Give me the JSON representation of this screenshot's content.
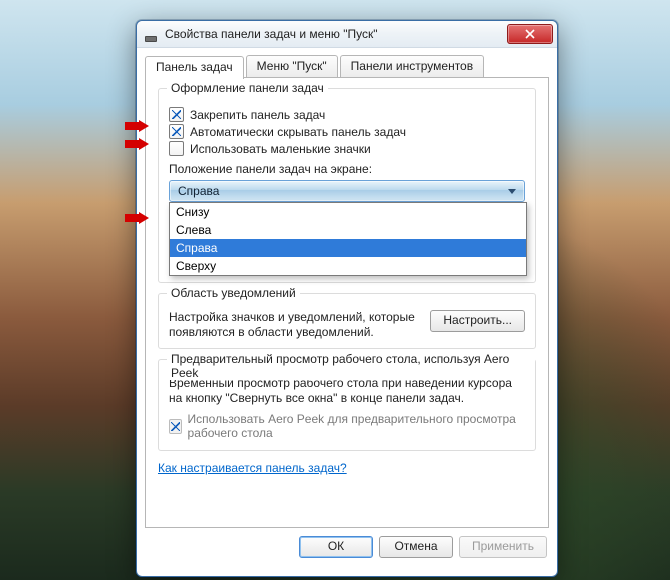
{
  "window": {
    "title": "Свойства панели задач и меню \"Пуск\""
  },
  "tabs": {
    "taskbar": "Панель задач",
    "start": "Меню \"Пуск\"",
    "toolbars": "Панели инструментов"
  },
  "appearance": {
    "legend": "Оформление панели задач",
    "lock": "Закрепить панель задач",
    "autohide": "Автоматически скрывать панель задач",
    "smallicons": "Использовать маленькие значки",
    "position_label": "Положение панели задач на экране:",
    "position_selected": "Справа",
    "options": [
      "Снизу",
      "Слева",
      "Справа",
      "Сверху"
    ]
  },
  "notify": {
    "legend": "Область уведомлений",
    "text": "Настройка значков и уведомлений, которые появляются в области уведомлений.",
    "button": "Настроить..."
  },
  "aeropeek": {
    "legend": "Предварительный просмотр рабочего стола, используя Aero Peek",
    "text": "Временный просмотр рабочего стола при наведении курсора на кнопку \"Свернуть все окна\" в конце панели задач.",
    "chk": "Использовать Aero Peek для предварительного просмотра рабочего стола"
  },
  "help_link": "Как настраивается панель задач?",
  "buttons": {
    "ok": "ОК",
    "cancel": "Отмена",
    "apply": "Применить"
  }
}
